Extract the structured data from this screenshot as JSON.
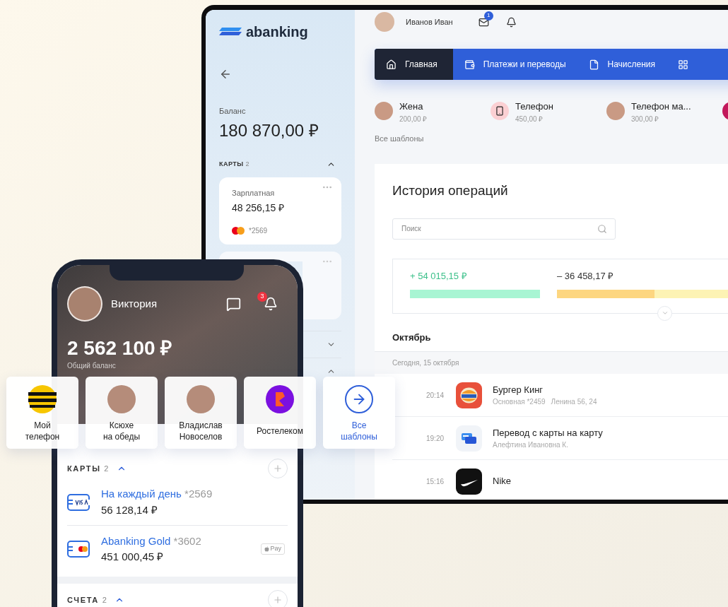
{
  "desktop": {
    "logo": "abanking",
    "sidebar": {
      "balance_label": "Баланс",
      "balance": "180 870,00 ₽",
      "cards_header": {
        "label": "КАРТЫ",
        "count": "2",
        "expanded": true
      },
      "cards": [
        {
          "name": "Зарплатная",
          "amount": "48 256,15 ₽",
          "number": "*2569"
        }
      ],
      "sections": [
        {
          "expanded": false
        },
        {
          "expanded": true
        }
      ]
    },
    "user": {
      "name": "Иванов Иван"
    },
    "mail_badge": "1",
    "nav": [
      {
        "label": "Главная",
        "selected": true,
        "kind": "home"
      },
      {
        "label": "Платежи и переводы",
        "selected": false,
        "kind": "payments"
      },
      {
        "label": "Начисления",
        "selected": false,
        "kind": "charges"
      },
      {
        "selected": false,
        "kind": "more"
      }
    ],
    "templates": [
      {
        "name": "Жена",
        "amount": "200,00 ₽",
        "kind": "person"
      },
      {
        "name": "Телефон",
        "amount": "450,00 ₽",
        "kind": "phone"
      },
      {
        "name": "Телефон ма...",
        "amount": "300,00 ₽",
        "kind": "person"
      },
      {
        "kind": "app"
      }
    ],
    "all_templates": "Все шаблоны",
    "history": {
      "title": "История операций",
      "search_placeholder": "Поиск",
      "income": "+ 54 015,15 ₽",
      "expense": "– 36 458,17 ₽",
      "month": "Октябрь",
      "date": "Сегодня, 15 октября",
      "operations": [
        {
          "time": "20:14",
          "title": "Бургер Кинг",
          "details": [
            "Основная *2459",
            "Ленина 56, 24"
          ],
          "kind": "burger"
        },
        {
          "time": "19:20",
          "title": "Перевод с карты на карту",
          "details": [
            "Алефтина Ивановна К."
          ],
          "kind": "transfer"
        },
        {
          "time": "15:16",
          "title": "Nike",
          "kind": "nike"
        }
      ]
    }
  },
  "phone": {
    "user": "Виктория",
    "bell_badge": "3",
    "balance": "2 562 100 ₽",
    "balance_label": "Общий баланс",
    "cards_section": {
      "label": "КАРТЫ",
      "count": "2",
      "expanded": true,
      "cards": [
        {
          "name": "На каждый день",
          "number": "*2569",
          "amount": "56 128,14 ₽",
          "kind": "visa"
        },
        {
          "name": "Abanking Gold",
          "number": "*3602",
          "amount": "451 000,45 ₽",
          "kind": "mastercard",
          "badge": "Pay"
        }
      ]
    },
    "accounts_section": {
      "label": "СЧЕТА",
      "count": "2",
      "expanded": true
    }
  },
  "quick_templates": [
    {
      "label": "Мой\nтелефон",
      "kind": "operator"
    },
    {
      "label": "Ксюхе\nна обеды",
      "kind": "person"
    },
    {
      "label": "Владислав\nНовоселов",
      "kind": "person"
    },
    {
      "label": "Ростелеком",
      "kind": "provider"
    },
    {
      "label": "Все\nшаблоны",
      "kind": "all"
    }
  ]
}
